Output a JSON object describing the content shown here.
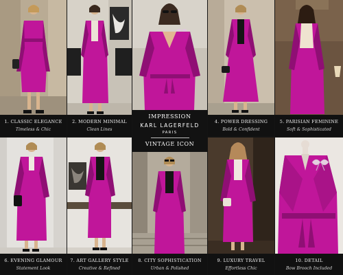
{
  "center": {
    "line1": "IMPRESSION",
    "brand": "KARL LAGERFELD",
    "city": "PARIS",
    "line2": "VINTAGE ICON"
  },
  "colors": {
    "suit": "#c0169a",
    "suit_shadow": "#8f0f74",
    "caption_bg": "#111111",
    "caption_text": "#f2f2f2"
  },
  "tiles": [
    {
      "title": "1. CLASSIC ELEGANCE",
      "subtitle": "Timeless & Chic"
    },
    {
      "title": "2. MODERN MINIMAL",
      "subtitle": "Clean Lines"
    },
    {
      "title": "4. POWER DRESSING",
      "subtitle": "Bold & Confident"
    },
    {
      "title": "5. PARISIAN FEMININE",
      "subtitle": "Soft & Sophisticated"
    },
    {
      "title": "6. EVENING GLAMOUR",
      "subtitle": "Statement Look"
    },
    {
      "title": "7. ART GALLERY STYLE",
      "subtitle": "Creative & Refined"
    },
    {
      "title": "8. CITY SOPHISTICATION",
      "subtitle": "Urban & Polished"
    },
    {
      "title": "9. LUXURY TRAVEL",
      "subtitle": "Effortless Chic"
    },
    {
      "title": "10. DETAIL",
      "subtitle": "Bow Brooch Included"
    }
  ]
}
